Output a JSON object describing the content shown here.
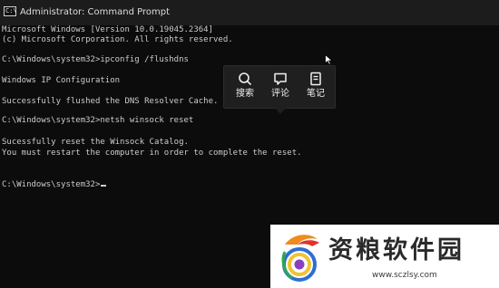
{
  "window": {
    "title": "Administrator: Command Prompt",
    "icon": "command-prompt-icon",
    "icon_text": "C:\\"
  },
  "console": {
    "lines": [
      "Microsoft Windows [Version 10.0.19045.2364]",
      "(c) Microsoft Corporation. All rights reserved.",
      "",
      "C:\\Windows\\system32>ipconfig /flushdns",
      "",
      "Windows IP Configuration",
      "",
      "Successfully flushed the DNS Resolver Cache.",
      "",
      "C:\\Windows\\system32>netsh winsock reset",
      "",
      "Sucessfully reset the Winsock Catalog.",
      "You must restart the computer in order to complete the reset.",
      "",
      "",
      "C:\\Windows\\system32>"
    ],
    "text_color": "#cccccc",
    "background": "#0c0c0c"
  },
  "popup": {
    "items": [
      {
        "label": "搜索",
        "icon": "search-icon"
      },
      {
        "label": "评论",
        "icon": "comment-icon"
      },
      {
        "label": "笔记",
        "icon": "note-icon"
      }
    ]
  },
  "watermark": {
    "title": "资粮软件园",
    "url": "www.sczlsy.com"
  }
}
